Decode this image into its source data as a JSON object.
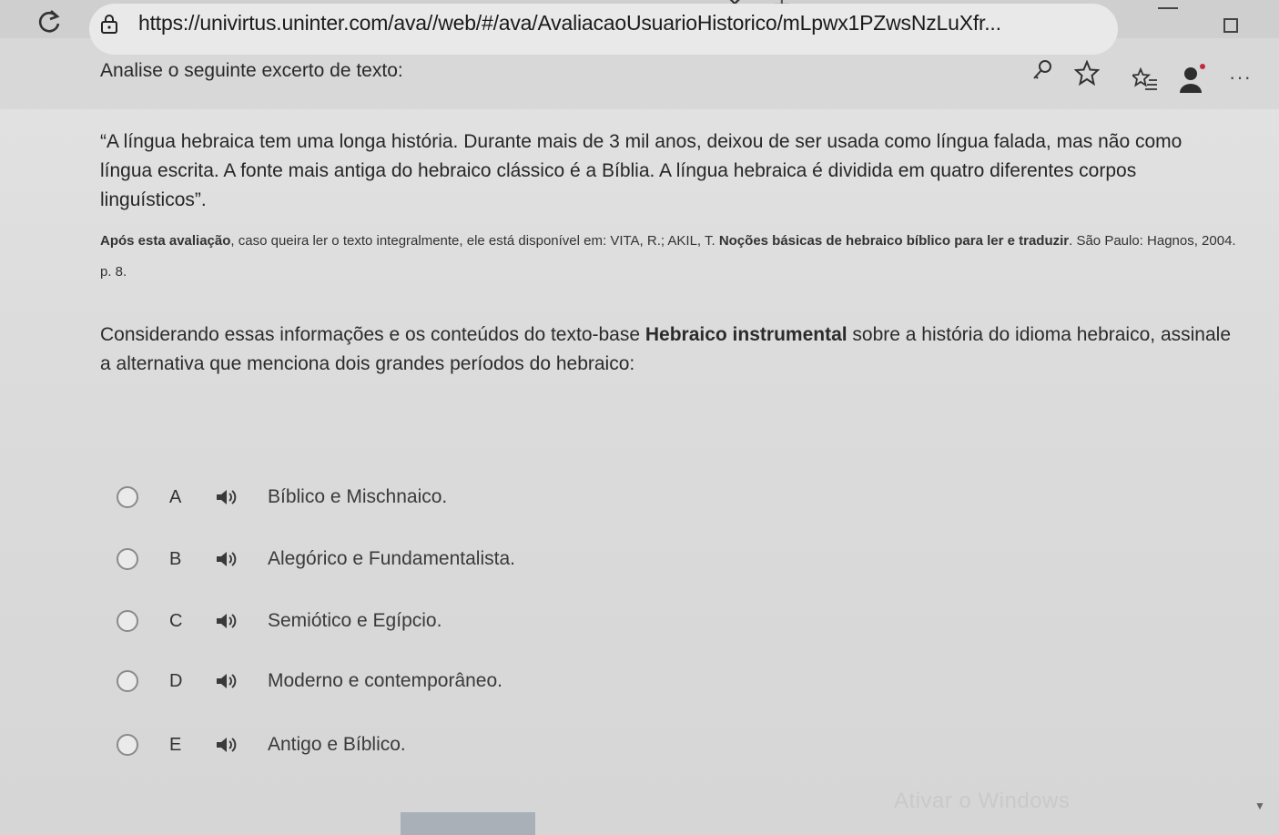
{
  "browser": {
    "url": "https://univirtus.uninter.com/ava//web/#/ava/AvaliacaoUsuarioHistorico/mLpwx1PZwsNzLuXfr..."
  },
  "content": {
    "intro": "Analise o seguinte excerto de texto:",
    "quote": "“A língua hebraica tem uma longa história. Durante mais de 3 mil anos, deixou de ser usada como língua falada, mas não como língua escrita. A fonte mais antiga do hebraico clássico é a Bíblia. A língua hebraica é dividida em quatro diferentes corpos linguísticos”.",
    "reference_lead": "Após esta avaliação",
    "reference_mid": ", caso queira ler o texto integralmente, ele está disponível em: VITA, R.; AKIL, T. ",
    "reference_title": "Noções básicas de hebraico bíblico para ler e traduzir",
    "reference_tail": ". São Paulo: Hagnos, 2004. p. 8.",
    "question_pre": "Considerando essas informações e os conteúdos do texto-base ",
    "question_bold": "Hebraico instrumental",
    "question_post": " sobre a história do idioma hebraico, assinale a alternativa que menciona dois grandes períodos do hebraico:"
  },
  "options": [
    {
      "letter": "A",
      "text": "Bíblico e Mischnaico."
    },
    {
      "letter": "B",
      "text": "Alegórico e Fundamentalista."
    },
    {
      "letter": "C",
      "text": "Semiótico e Egípcio."
    },
    {
      "letter": "D",
      "text": "Moderno e contemporâneo."
    },
    {
      "letter": "E",
      "text": "Antigo e Bíblico."
    }
  ],
  "watermark": "Ativar o Windows",
  "icons": [
    "reload-icon",
    "lock-icon",
    "key-icon",
    "star-icon",
    "favorites-icon",
    "profile-icon",
    "more-icon",
    "audio-icon"
  ]
}
